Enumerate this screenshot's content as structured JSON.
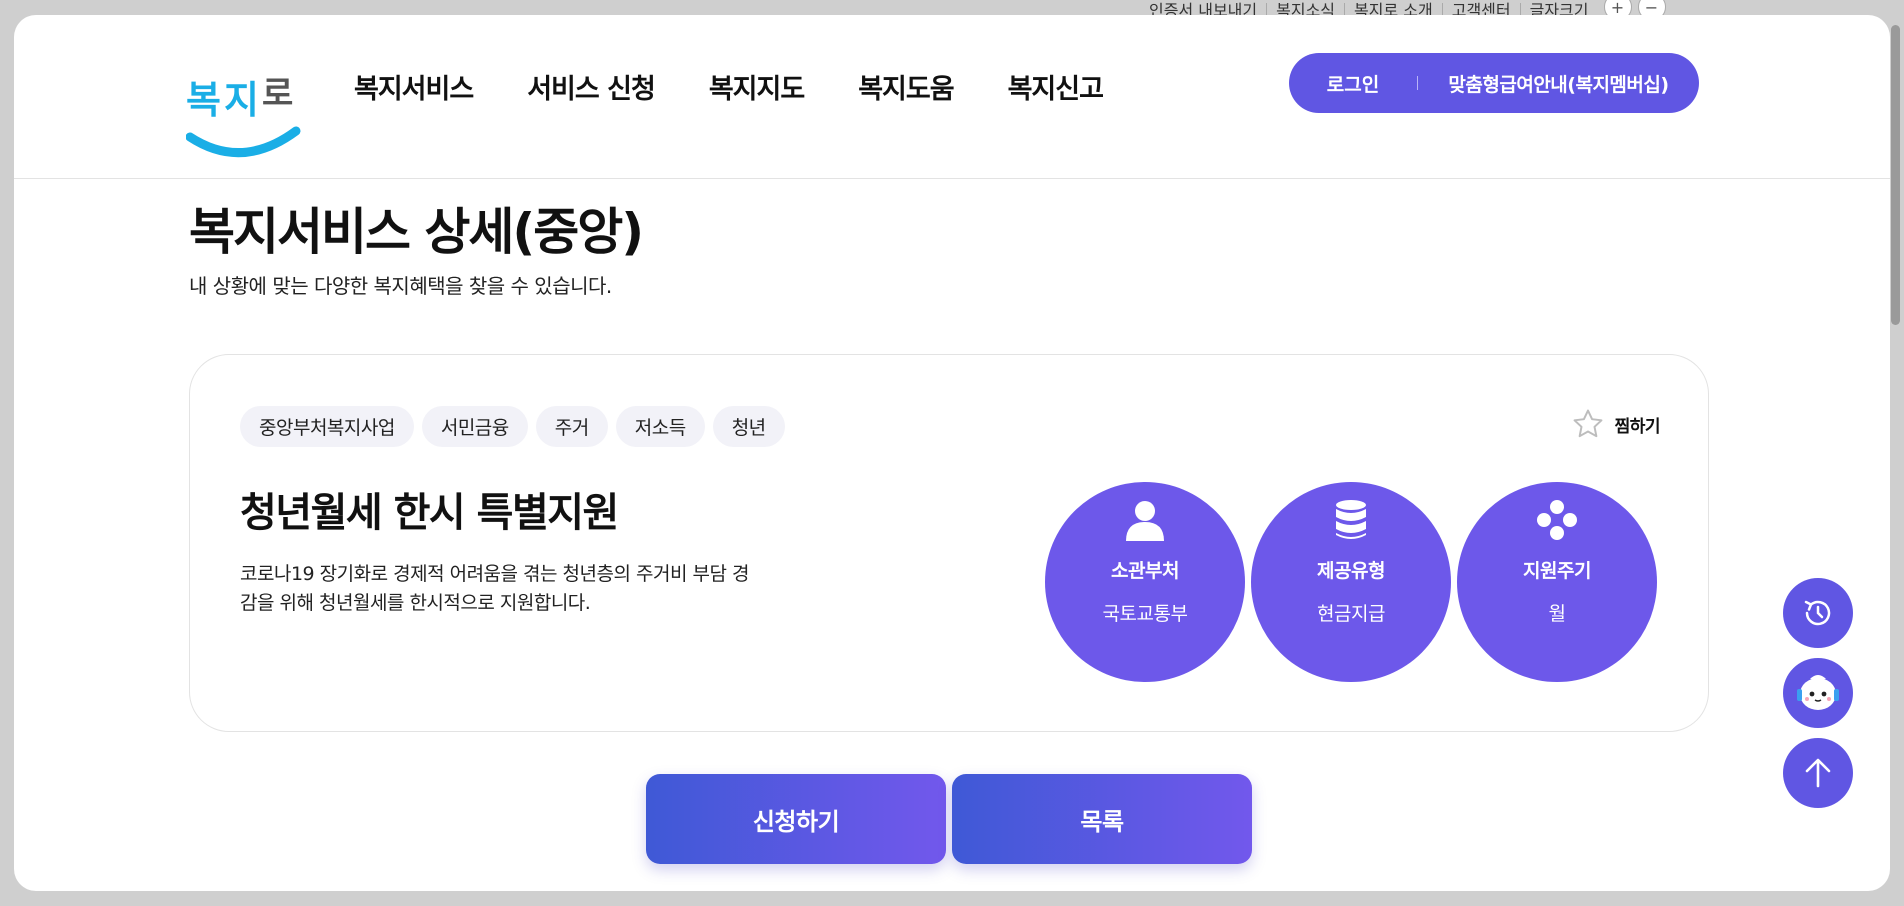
{
  "utility": {
    "links": [
      "인증서 내보내기",
      "복지소식",
      "복지로 소개",
      "고객센터",
      "글자크기"
    ],
    "font_plus": "+",
    "font_minus": "−"
  },
  "header": {
    "logo_text": "복지로",
    "nav": [
      "복지서비스",
      "서비스 신청",
      "복지지도",
      "복지도움",
      "복지신고"
    ],
    "login_label": "로그인",
    "membership_label": "맞춤형급여안내(복지멤버십)"
  },
  "page": {
    "title": "복지서비스 상세(중앙)",
    "subtitle": "내 상황에 맞는 다양한 복지혜택을 찾을 수 있습니다."
  },
  "service": {
    "tags": [
      "중앙부처복지사업",
      "서민금융",
      "주거",
      "저소득",
      "청년"
    ],
    "favorite_label": "찜하기",
    "title": "청년월세 한시 특별지원",
    "description": "코로나19 장기화로 경제적 어려움을 겪는 청년층의 주거비 부담 경감을 위해 청년월세를 한시적으로 지원합니다.",
    "info": [
      {
        "icon": "person-icon",
        "label": "소관부처",
        "value": "국토교통부"
      },
      {
        "icon": "database-icon",
        "label": "제공유형",
        "value": "현금지급"
      },
      {
        "icon": "dots-icon",
        "label": "지원주기",
        "value": "월"
      }
    ]
  },
  "actions": {
    "apply_label": "신청하기",
    "list_label": "목록"
  },
  "floating": {
    "history_icon": "history-icon",
    "chatbot_icon": "chatbot-icon",
    "top_icon": "arrow-up-icon"
  },
  "colors": {
    "primary": "#6056e3",
    "circle": "#6d58ea",
    "gradient_start": "#3f59d6",
    "gradient_end": "#7258ec",
    "logo_blue": "#1aaee6"
  }
}
